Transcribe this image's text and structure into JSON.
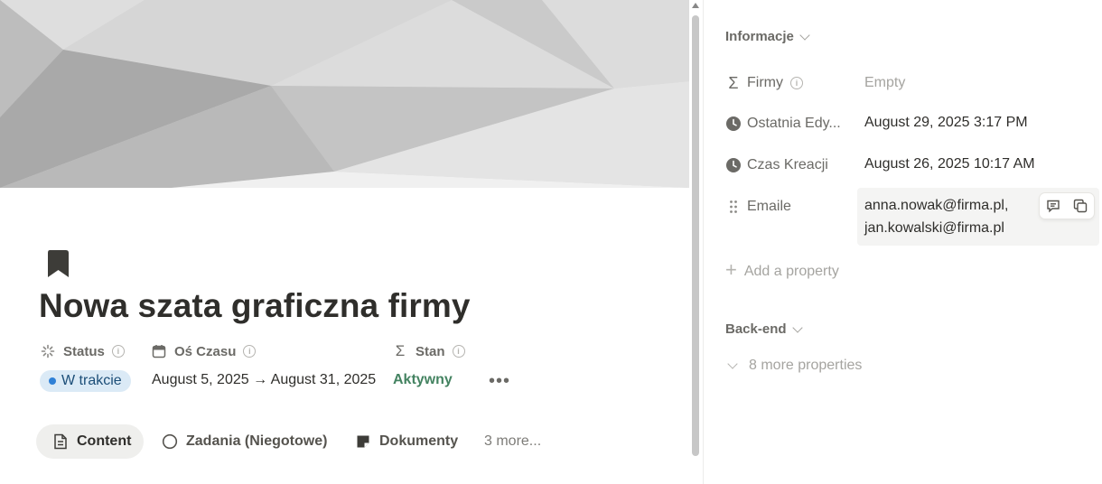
{
  "page": {
    "title": "Nowa szata graficzna firmy",
    "page_icon": "bookmark-icon",
    "properties": [
      {
        "name": "Status",
        "icon": "status-icon",
        "value": "W trakcie",
        "value_color": "#2f80d6"
      },
      {
        "name": "Oś Czasu",
        "icon": "calendar-icon",
        "value": "August 5, 2025 → August 31, 2025"
      },
      {
        "name": "Stan",
        "icon": "sigma-icon",
        "value": "Aktywny",
        "value_color": "#448361"
      }
    ],
    "more_menu": "•••",
    "tabs": [
      {
        "label": "Content",
        "icon": "document-icon",
        "active": true
      },
      {
        "label": "Zadania (Niegotowe)",
        "icon": "circle-icon",
        "active": false
      },
      {
        "label": "Dokumenty",
        "icon": "note-icon",
        "active": false
      },
      {
        "label": "3 more...",
        "icon": "",
        "active": false
      }
    ]
  },
  "sidebar": {
    "section_informacje": "Informacje",
    "properties": [
      {
        "name": "Firmy",
        "icon": "sigma-icon",
        "value": "Empty"
      },
      {
        "name": "Ostatnia Edy...",
        "icon": "clock-icon",
        "value": "August 29, 2025 3:17 PM"
      },
      {
        "name": "Czas Kreacji",
        "icon": "clock-icon",
        "value": "August 26, 2025 10:17 AM"
      },
      {
        "name": "Emaile",
        "icon": "drag-handle-icon",
        "value_lines": [
          "anna.nowak@firma.pl,",
          "jan.kowalski@firma.pl"
        ]
      }
    ],
    "add_property": "Add a property",
    "section_backend": "Back-end",
    "more_properties": "8 more properties"
  },
  "colors": {
    "accent_blue": "#2f80d6",
    "status_badge_bg": "#dbeaf6",
    "green": "#448361",
    "text_primary": "#2f2e2b",
    "text_secondary": "#6b6a66"
  }
}
